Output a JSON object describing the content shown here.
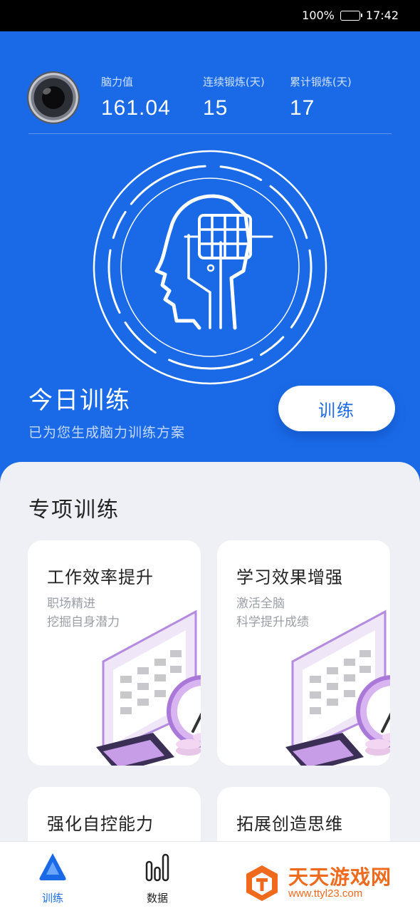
{
  "status_bar": {
    "battery": "100%",
    "time": "17:42"
  },
  "stats": [
    {
      "label": "脑力值",
      "value": "161.04"
    },
    {
      "label": "连续锻炼(天)",
      "value": "15"
    },
    {
      "label": "累计锻炼(天)",
      "value": "17"
    }
  ],
  "today": {
    "title": "今日训练",
    "subtitle": "已为您生成脑力训练方案",
    "button": "训练"
  },
  "special": {
    "title": "专项训练",
    "cards": [
      {
        "title": "工作效率提升",
        "lines": [
          "职场精进",
          "挖掘自身潜力"
        ]
      },
      {
        "title": "学习效果增强",
        "lines": [
          "激活全脑",
          "科学提升成绩"
        ]
      },
      {
        "title": "强化自控能力"
      },
      {
        "title": "拓展创造思维"
      }
    ]
  },
  "tabs": [
    {
      "label": "训练",
      "icon": "train-triangle-icon"
    },
    {
      "label": "数据",
      "icon": "bar-chart-icon"
    }
  ],
  "watermark": {
    "title": "天天游戏网",
    "url": "www.ttyl23.com"
  },
  "colors": {
    "primary": "#1a6ae8",
    "background": "#eef0f5",
    "watermark": "#f06a1d"
  }
}
